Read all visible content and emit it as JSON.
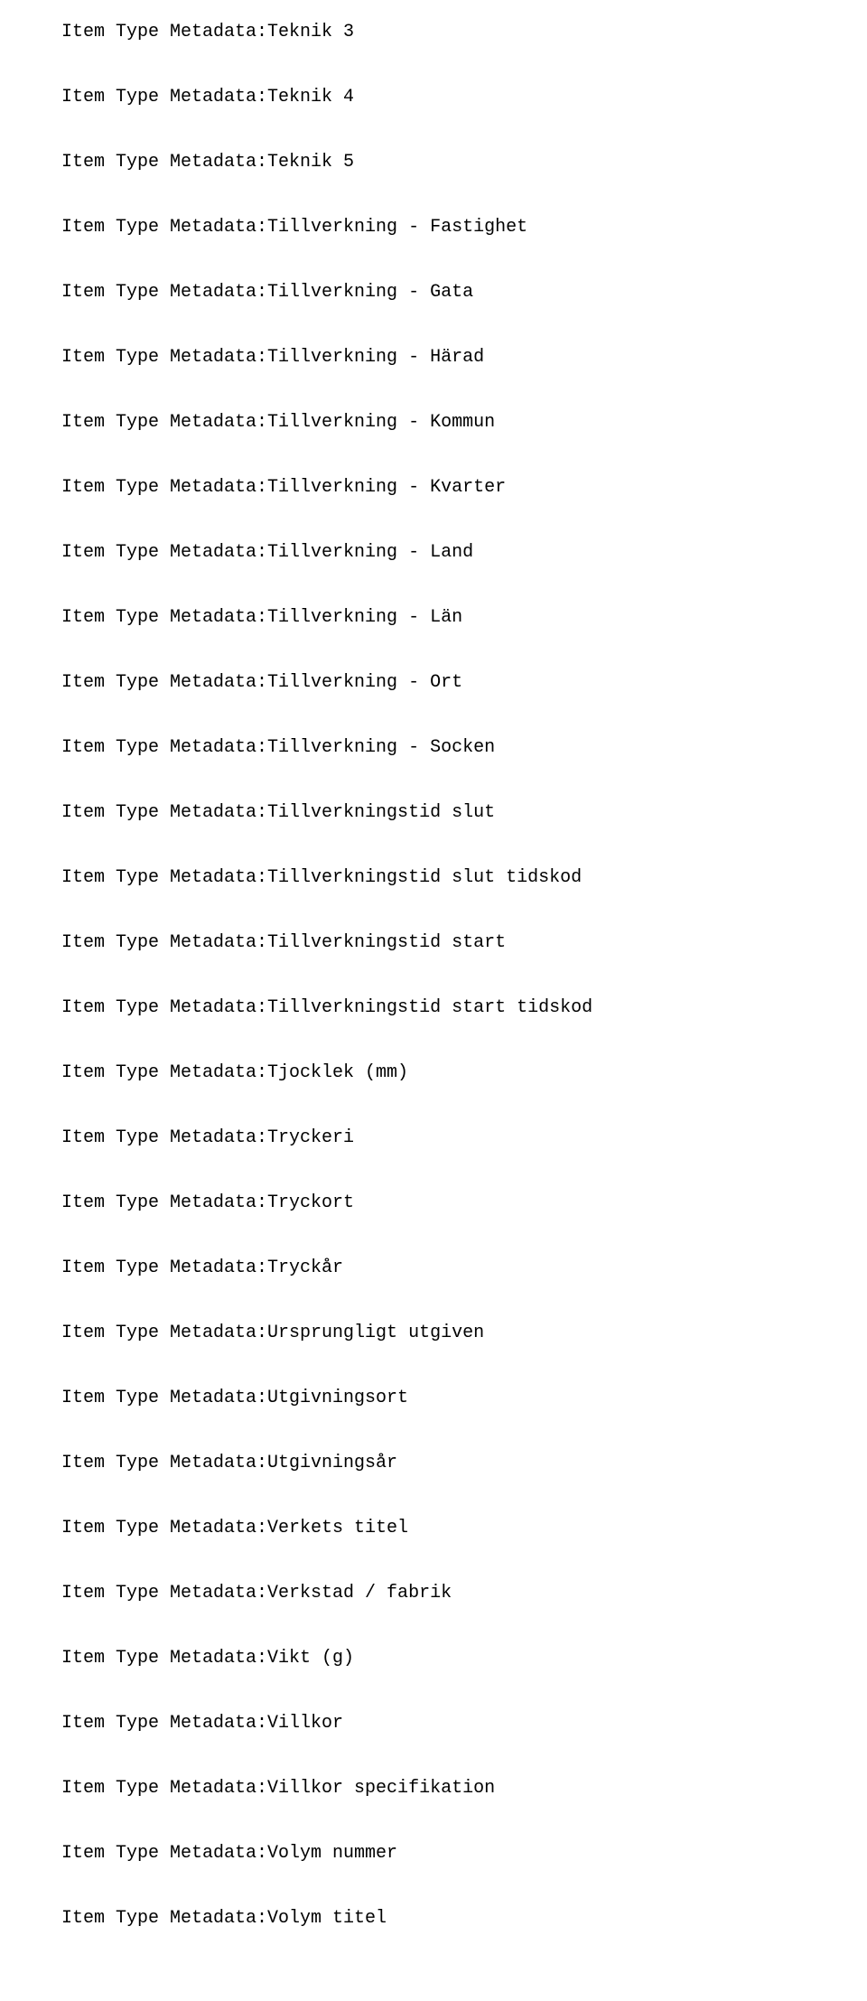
{
  "lines": [
    "Item Type Metadata:Teknik 3",
    "Item Type Metadata:Teknik 4",
    "Item Type Metadata:Teknik 5",
    "Item Type Metadata:Tillverkning - Fastighet",
    "Item Type Metadata:Tillverkning - Gata",
    "Item Type Metadata:Tillverkning - Härad",
    "Item Type Metadata:Tillverkning - Kommun",
    "Item Type Metadata:Tillverkning - Kvarter",
    "Item Type Metadata:Tillverkning - Land",
    "Item Type Metadata:Tillverkning - Län",
    "Item Type Metadata:Tillverkning - Ort",
    "Item Type Metadata:Tillverkning - Socken",
    "Item Type Metadata:Tillverkningstid slut",
    "Item Type Metadata:Tillverkningstid slut tidskod",
    "Item Type Metadata:Tillverkningstid start",
    "Item Type Metadata:Tillverkningstid start tidskod",
    "Item Type Metadata:Tjocklek (mm)",
    "Item Type Metadata:Tryckeri",
    "Item Type Metadata:Tryckort",
    "Item Type Metadata:Tryckår",
    "Item Type Metadata:Ursprungligt utgiven",
    "Item Type Metadata:Utgivningsort",
    "Item Type Metadata:Utgivningsår",
    "Item Type Metadata:Verkets titel",
    "Item Type Metadata:Verkstad / fabrik",
    "Item Type Metadata:Vikt (g)",
    "Item Type Metadata:Villkor",
    "Item Type Metadata:Villkor specifikation",
    "Item Type Metadata:Volym nummer",
    "Item Type Metadata:Volym titel"
  ]
}
